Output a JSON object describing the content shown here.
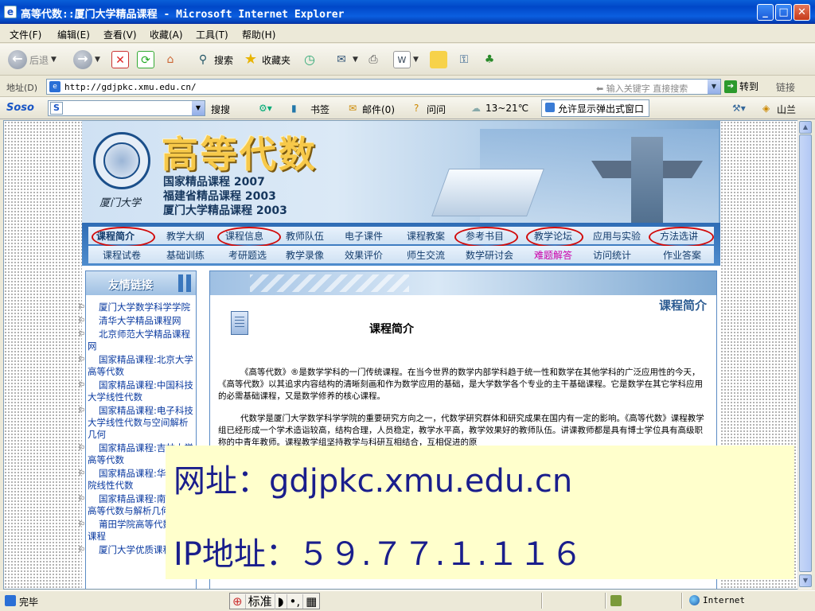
{
  "window": {
    "title": "高等代数::厦门大学精品课程 - Microsoft Internet Explorer",
    "min_glyph": "_",
    "max_glyph": "□",
    "close_glyph": "✕"
  },
  "menu": [
    "文件(F)",
    "编辑(E)",
    "查看(V)",
    "收藏(A)",
    "工具(T)",
    "帮助(H)"
  ],
  "toolbar": {
    "back": "后退",
    "search": "搜索",
    "favorites": "收藏夹"
  },
  "address": {
    "label": "地址(D)",
    "url": "http://gdjpkc.xmu.edu.cn/",
    "hint": "⬅ 输入关键字 直接搜索",
    "go": "转到",
    "links": "链接"
  },
  "sosobar": {
    "logo": "Soso",
    "search_btn": "搜搜",
    "bookmarks": "书签",
    "mail": "邮件(0)",
    "ask": "问问",
    "weather": "13~21℃",
    "popup": "允许显示弹出式窗口",
    "shanlan": "山兰"
  },
  "banner": {
    "title": "高等代数",
    "line1": "国家精品课程 2007",
    "line2": "福建省精品课程 2003",
    "line3": "厦门大学精品课程 2003",
    "signature": "厦门大学"
  },
  "nav_row1": [
    "课程简介",
    "教学大纲",
    "课程信息",
    "教师队伍",
    "电子课件",
    "课程教案",
    "参考书目",
    "教学论坛",
    "应用与实验",
    "方法选讲"
  ],
  "nav_row2": [
    "课程试卷",
    "基础训练",
    "考研题选",
    "教学录像",
    "效果评价",
    "师生交流",
    "数学研讨会",
    "难题解答",
    "访问统计",
    "作业答案"
  ],
  "friends": {
    "title": "友情链接",
    "items": [
      "厦门大学数学科学学院",
      "清华大学精品课程网",
      "北京师范大学精品课程网",
      "国家精品课程:北京大学高等代数",
      "国家精品课程:中国科技大学线性代数",
      "国家精品课程:电子科技大学线性代数与空间解析几何",
      "国家精品课程:吉林大学高等代数",
      "国家精品课程:华北工学院线性代数",
      "国家精品课程:南开大学高等代数与解析几何",
      "莆田学院高等代数精品课程",
      "厦门大学优质课程"
    ]
  },
  "main": {
    "header_label": "课程简介",
    "article_title": "课程简介",
    "p1": "《高等代数》®是数学学科的一门传统课程。在当今世界的数学内部学科趋于统一性和数学在其他学科的广泛应用性的今天，《高等代数》以其追求内容结构的清晰刻画和作为数学应用的基础，是大学数学各个专业的主干基础课程。它是数学在其它学科应用的必需基础课程，又是数学修养的核心课程。",
    "p2": "代数学是厦门大学数学科学学院的重要研究方向之一，代数学研究群体和研究成果在国内有一定的影响。《高等代数》课程教学组已经形成一个学术造诣较高，结构合理，人员稳定，教学水平高，教学效果好的教师队伍。讲课教师都是具有博士学位具有高级职称的中青年教师。课程教学组坚持教学与科研互相结合，互相促进的原"
  },
  "overlay": {
    "url_line": "网址：gdjpkc.xmu.edu.cn",
    "ip_line": "IP地址：５９.７７.１.１１６"
  },
  "status": {
    "text": "完毕",
    "ime_mode": "标准",
    "zone": "Internet"
  }
}
